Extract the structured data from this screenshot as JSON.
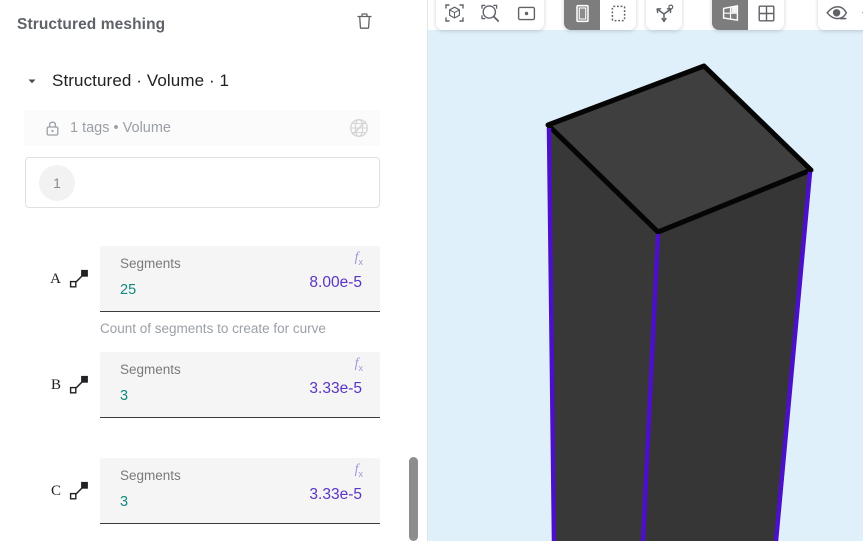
{
  "panel": {
    "title": "Structured meshing",
    "group": {
      "caret_icon": "caret-down-icon",
      "label_parts": [
        "Structured",
        "Volume",
        "1"
      ],
      "label": "Structured · Volume · 1",
      "delete_icon": "trash-icon"
    },
    "tags_row": {
      "lock_icon": "lock-icon",
      "label": "1 tags • Volume",
      "globe_icon": "globe-icon"
    },
    "selection_input": {
      "chip_value": "1",
      "placeholder": ""
    },
    "parameters": [
      {
        "letter": "A",
        "icon": "edge-curve-icon",
        "label": "Segments",
        "value": "25",
        "expression": "8.00e-5",
        "fx_icon": "fx-icon",
        "help": "Count of segments to create for curve"
      },
      {
        "letter": "B",
        "icon": "edge-curve-icon",
        "label": "Segments",
        "value": "3",
        "expression": "3.33e-5",
        "fx_icon": "fx-icon",
        "help": ""
      },
      {
        "letter": "C",
        "icon": "edge-curve-icon",
        "label": "Segments",
        "value": "3",
        "expression": "3.33e-5",
        "fx_icon": "fx-icon",
        "help": ""
      }
    ],
    "scrollbar": {
      "name": "vertical-scrollbar"
    }
  },
  "viewport": {
    "background_color": "#dff0fb",
    "model": {
      "name": "extruded-box",
      "face_color": "#363636",
      "top_face_color": "#3e3e3e",
      "edge_color": "#000000",
      "highlight_edge_color": "#4b10c8"
    },
    "toolbars": [
      {
        "name": "view-tools",
        "buttons": [
          {
            "name": "fit-to-view-button",
            "icon": "cube-fit-icon",
            "active": false
          },
          {
            "name": "zoom-box-button",
            "icon": "magnifier-icon",
            "active": false
          },
          {
            "name": "center-view-button",
            "icon": "target-frame-icon",
            "active": false
          }
        ]
      },
      {
        "name": "selection-mode-tools",
        "buttons": [
          {
            "name": "solid-select-button",
            "icon": "solid-face-icon",
            "active": true
          },
          {
            "name": "box-select-button",
            "icon": "dashed-box-icon",
            "active": false
          }
        ]
      },
      {
        "name": "axis-tools",
        "buttons": [
          {
            "name": "axes-orientation-button",
            "icon": "axes-icon",
            "active": false
          }
        ]
      },
      {
        "name": "display-mode-tools",
        "buttons": [
          {
            "name": "shaded-view-button",
            "icon": "shaded-panel-icon",
            "active": true
          },
          {
            "name": "grid-view-button",
            "icon": "grid-icon",
            "active": false
          }
        ]
      },
      {
        "name": "visibility-tools",
        "buttons": [
          {
            "name": "show-all-button",
            "icon": "eye-plus-icon",
            "active": false
          },
          {
            "name": "hide-all-button",
            "icon": "eye-minus-icon",
            "active": false
          }
        ]
      }
    ]
  }
}
